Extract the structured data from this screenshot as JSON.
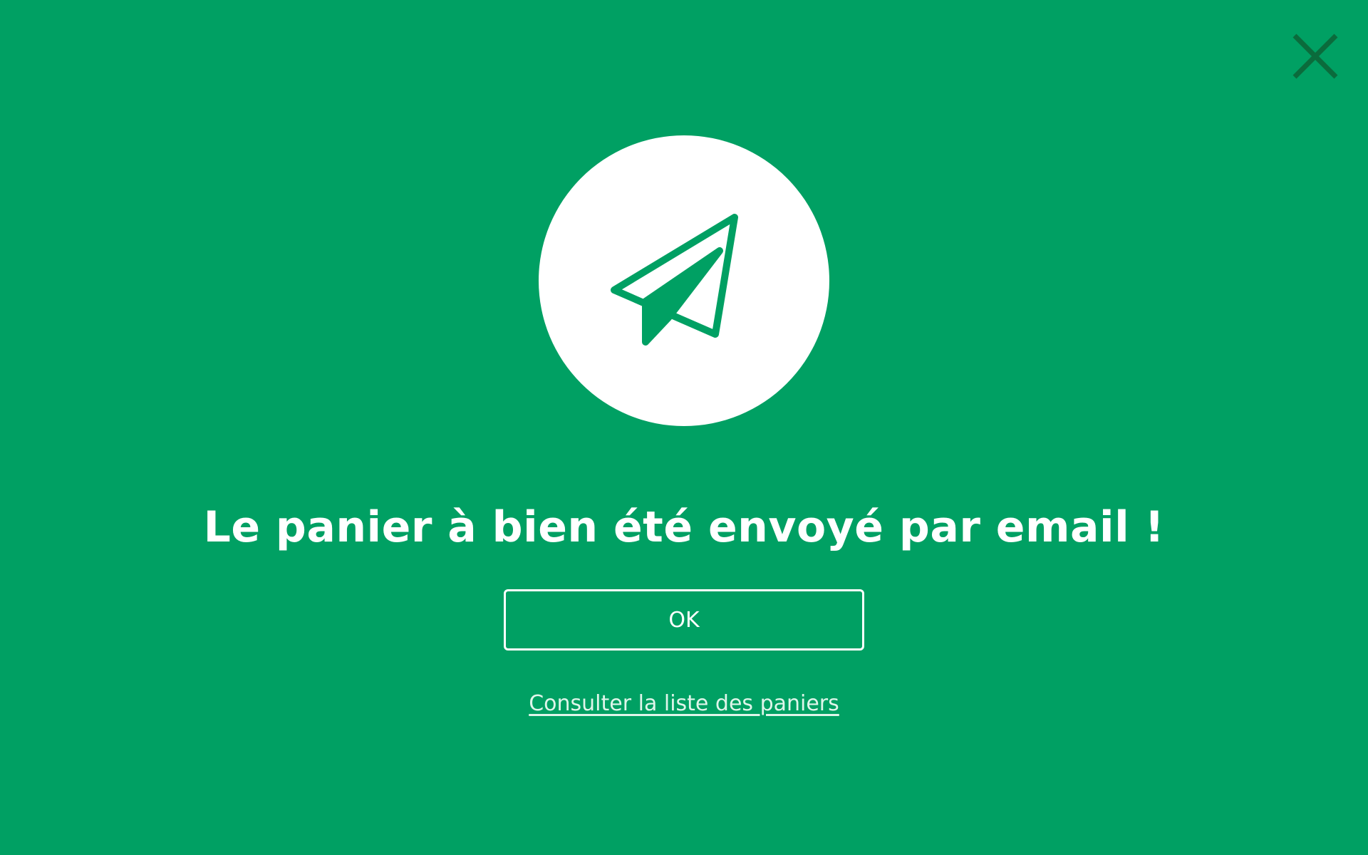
{
  "dialog": {
    "title": "Le panier à bien été envoyé par email !",
    "ok_label": "OK",
    "list_link_label": "Consulter la liste des paniers"
  },
  "icons": {
    "close": "close-icon",
    "hero": "paper-plane-icon"
  },
  "colors": {
    "background": "#00a063",
    "close_icon": "#0b6b3c",
    "circle": "#ffffff",
    "text": "#ffffff",
    "link": "#dff5ea"
  }
}
